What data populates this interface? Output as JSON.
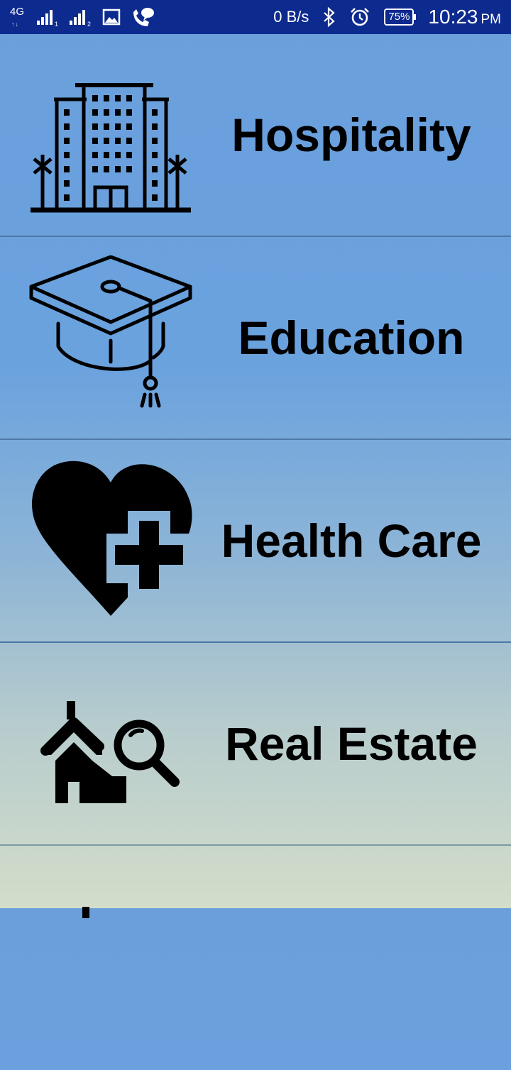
{
  "status_bar": {
    "network_type": "4G",
    "sim1_label": "1",
    "sim2_label": "2",
    "data_speed": "0 B/s",
    "battery": "75%",
    "time": "10:23",
    "ampm": "PM",
    "icons": [
      "network-4g-icon",
      "signal-sim1-icon",
      "signal-sim2-icon",
      "gallery-notification-icon",
      "call-chat-notification-icon",
      "bluetooth-icon",
      "alarm-icon",
      "battery-icon"
    ]
  },
  "categories": [
    {
      "label": "Hospitality",
      "icon": "hotel-building-icon"
    },
    {
      "label": "Education",
      "icon": "graduation-cap-icon"
    },
    {
      "label": "Health Care",
      "icon": "heart-plus-icon"
    },
    {
      "label": "Real Estate",
      "icon": "house-search-icon"
    }
  ]
}
